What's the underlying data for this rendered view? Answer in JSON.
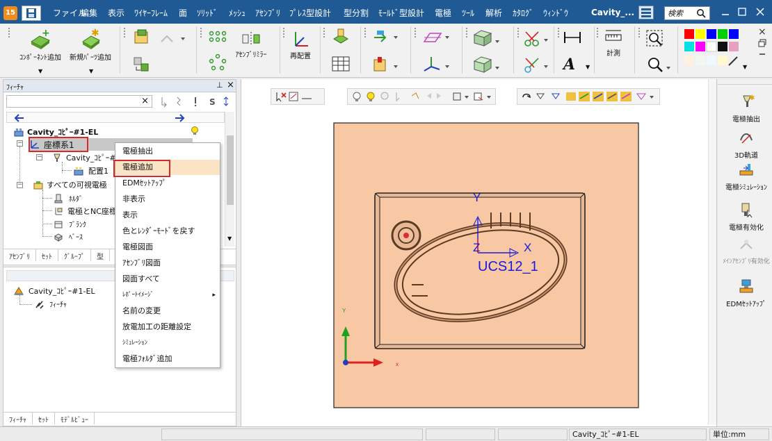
{
  "app": {
    "logo": "15",
    "title": "Cavity_..."
  },
  "menu": [
    "ファイル",
    "編集",
    "表示",
    "ﾜｲﾔｰﾌﾚｰﾑ",
    "面",
    "ｿﾘｯﾄﾞ",
    "ﾒｯｼｭ",
    "ｱｾﾝﾌﾞﾘ",
    "ﾌﾟﾚｽ型設計",
    "型分割",
    "ﾓｰﾙﾄﾞ型設計",
    "電極",
    "ﾂｰﾙ",
    "解析",
    "ｶﾀﾛｸﾞ",
    "ｳｨﾝﾄﾞｳ"
  ],
  "search": {
    "placeholder": "検索"
  },
  "ribbon": {
    "component_add": "ｺﾝﾎﾟｰﾈﾝﾄ追加",
    "new_part_add": "新規ﾊﾟｰﾂ追加",
    "assembly_mirror": "ｱｾﾝﾌﾞﾘﾐﾗｰ",
    "reposition": "再配置",
    "measure": "計測"
  },
  "colors": {
    "menu_bg": "#1f5a94",
    "highlight": "#fbe3c6",
    "red_box": "#d8282a",
    "part_fill": "#f8c8a4",
    "ucs": "#1a1ad8"
  },
  "feature_panel": {
    "title": "ﾌｨｰﾁｬ",
    "pin": "⊥",
    "close": "×",
    "tree": {
      "root": "Cavity_ｺﾋﾟｰ#1-EL",
      "coord": "座標系1",
      "cavity_sub": "Cavity_ｺﾋﾟｰ#",
      "placement": "配置1",
      "all_visible": "すべての可視電極",
      "holder": "ﾎﾙﾀﾞ",
      "electrode_nc": "電極とNC座標",
      "blank": "ﾌﾞﾗﾝｸ",
      "base": "ﾍﾞｰｽ"
    },
    "tabs": [
      "ｱｾﾝﾌﾞﾘ",
      "ｾｯﾄ",
      "ｸﾞﾙｰﾌﾟ",
      "型"
    ]
  },
  "lower_panel": {
    "root": "Cavity_ｺﾋﾟｰ#1-EL",
    "child": "ﾌｨｰﾁｬ",
    "tabs": [
      "ﾌｨｰﾁｬ",
      "ｾｯﾄ",
      "ﾓﾃﾞﾙﾋﾞｭｰ"
    ]
  },
  "context_menu": [
    {
      "label": "電極抽出"
    },
    {
      "label": "電極追加"
    },
    {
      "label": "EDMｾｯﾄｱｯﾌﾟ"
    },
    {
      "label": "非表示"
    },
    {
      "label": "表示"
    },
    {
      "label": "色とﾚﾝﾀﾞｰﾓｰﾄﾞを戻す"
    },
    {
      "label": "電極図面"
    },
    {
      "label": "ｱｾﾝﾌﾞﾘ図面"
    },
    {
      "label": "図面すべて"
    },
    {
      "label": "ﾚﾎﾟｰﾄｲﾒｰｼﾞ"
    },
    {
      "label": "名前の変更"
    },
    {
      "label": "放電加工の距離設定"
    },
    {
      "label": "ｼﾐｭﾚｰｼｮﾝ"
    },
    {
      "label": "電極ﾌｫﾙﾀﾞ追加"
    }
  ],
  "viewport": {
    "ucs_label": "UCS12_1",
    "axis_x": "X",
    "axis_y": "Y",
    "axis_z": "Z",
    "triad_x": "x",
    "triad_y": "Y"
  },
  "right_panel": [
    {
      "label": "電極抽出",
      "icon": "electrode-extract-icon"
    },
    {
      "label": "3D軌道",
      "icon": "3d-path-icon"
    },
    {
      "label": "電極ｼﾐｭﾚｰｼｮﾝ",
      "icon": "electrode-simulation-icon"
    },
    {
      "label": "電極有効化",
      "icon": "electrode-activate-icon"
    },
    {
      "label": "ﾒｲﾝｱｾﾝﾌﾞﾘ有効化",
      "icon": "main-assembly-activate-icon"
    },
    {
      "label": "EDMｾｯﾄｱｯﾌﾟ",
      "icon": "edm-setup-icon"
    }
  ],
  "status": {
    "part": "Cavity_ｺﾋﾟｰ#1-EL",
    "units": "単位:mm"
  }
}
